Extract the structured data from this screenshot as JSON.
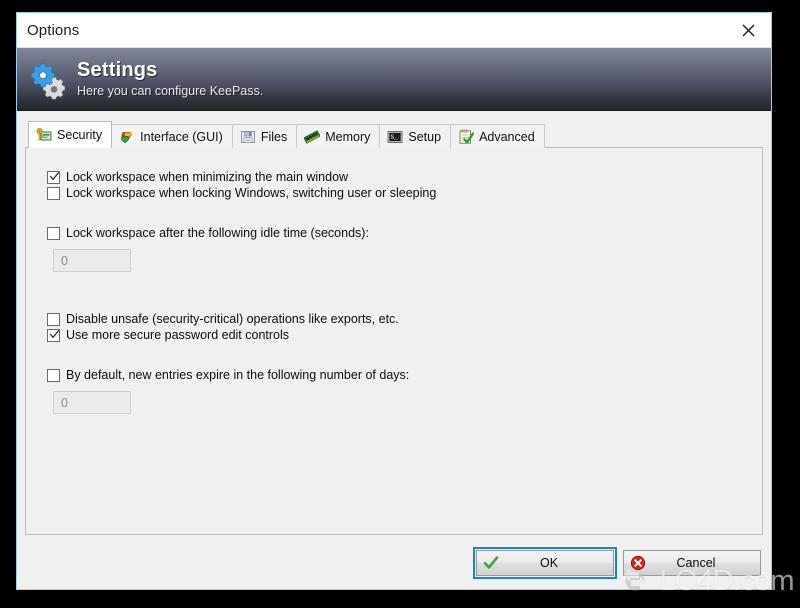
{
  "window": {
    "title": "Options",
    "close_icon": "close-icon"
  },
  "banner": {
    "icon": "gears-icon",
    "title": "Settings",
    "subtitle": "Here you can configure KeePass."
  },
  "tabs": [
    {
      "label": "Security",
      "icon": "key-card-icon",
      "selected": true
    },
    {
      "label": "Interface (GUI)",
      "icon": "hearts-icon",
      "selected": false
    },
    {
      "label": "Files",
      "icon": "floppy-disk-icon",
      "selected": false
    },
    {
      "label": "Memory",
      "icon": "ram-stick-icon",
      "selected": false
    },
    {
      "label": "Setup",
      "icon": "console-icon",
      "selected": false
    },
    {
      "label": "Advanced",
      "icon": "checklist-icon",
      "selected": false
    }
  ],
  "security": {
    "options": [
      {
        "label": "Lock workspace when minimizing the main window",
        "checked": true
      },
      {
        "label": "Lock workspace when locking Windows, switching user or sleeping",
        "checked": false
      },
      {
        "label": "Lock workspace after the following idle time (seconds):",
        "checked": false
      },
      {
        "label": "Disable unsafe (security-critical) operations like exports, etc.",
        "checked": false
      },
      {
        "label": "Use more secure password edit controls",
        "checked": true
      },
      {
        "label": "By default, new entries expire in the following number of days:",
        "checked": false
      }
    ],
    "idle_time_value": "0",
    "expire_days_value": "0"
  },
  "buttons": {
    "ok": {
      "label": "OK",
      "icon": "green-check-icon",
      "default": true
    },
    "cancel": {
      "label": "Cancel",
      "icon": "red-x-icon",
      "default": false
    }
  },
  "watermark": {
    "text": "LO4D.com",
    "icon": "recycle-arrows-icon"
  },
  "colors": {
    "window_border": "#9cd0f0",
    "banner_top": "#828799",
    "banner_bottom": "#24262e",
    "panel_bg": "#f0f0f0",
    "focus_ring": "#1f7fd4",
    "desktop": "#000000"
  }
}
